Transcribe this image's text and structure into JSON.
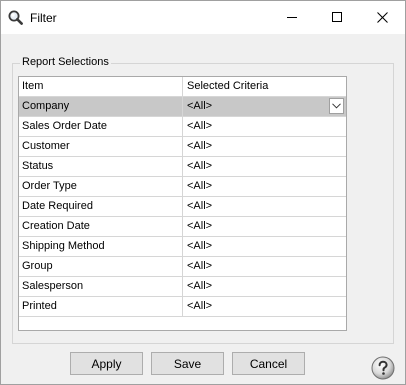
{
  "window": {
    "title": "Filter"
  },
  "group": {
    "legend": "Report Selections"
  },
  "grid": {
    "headers": {
      "item": "Item",
      "criteria": "Selected Criteria"
    },
    "rows": [
      {
        "item": "Company",
        "criteria": "<All>",
        "selected": true
      },
      {
        "item": "Sales Order Date",
        "criteria": "<All>"
      },
      {
        "item": "Customer",
        "criteria": "<All>"
      },
      {
        "item": "Status",
        "criteria": "<All>"
      },
      {
        "item": "Order Type",
        "criteria": "<All>"
      },
      {
        "item": "Date Required",
        "criteria": "<All>"
      },
      {
        "item": "Creation Date",
        "criteria": "<All>"
      },
      {
        "item": "Shipping Method",
        "criteria": "<All>"
      },
      {
        "item": "Group",
        "criteria": "<All>"
      },
      {
        "item": "Salesperson",
        "criteria": "<All>"
      },
      {
        "item": "Printed",
        "criteria": "<All>"
      }
    ]
  },
  "buttons": {
    "apply": "Apply",
    "save": "Save",
    "cancel": "Cancel"
  },
  "icons": {
    "app": "magnifier-icon",
    "minimize": "minimize-icon",
    "maximize": "maximize-icon",
    "close": "close-icon",
    "dropdown": "chevron-down-icon",
    "help": "help-icon"
  },
  "colors": {
    "selected_row": "#c8c8c8",
    "window_bg": "#f0f0f0",
    "grid_line": "#d6d6d6"
  }
}
